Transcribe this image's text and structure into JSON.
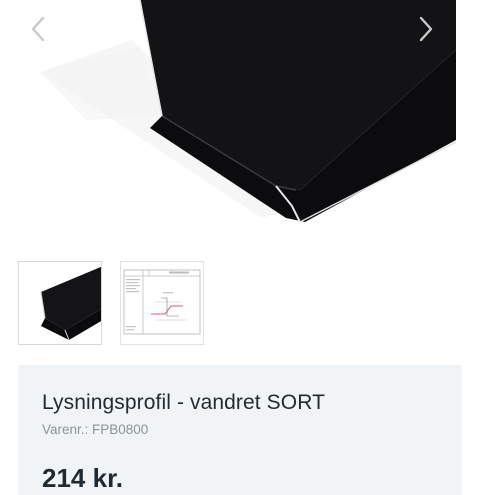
{
  "gallery": {
    "main_image": "lysningsprofil-black-profile-photo",
    "prev_icon": "chevron-left-icon",
    "next_icon": "chevron-right-icon",
    "thumbnails": [
      {
        "name": "thumbnail-photo",
        "image": "black-profile-photo",
        "selected": true
      },
      {
        "name": "thumbnail-drawing",
        "image": "technical-drawing",
        "selected": false
      }
    ]
  },
  "product": {
    "title": "Lysningsprofil - vandret SORT",
    "sku_label": "Varenr.:",
    "sku": "FPB0800",
    "sku_text": "Varenr.: FPB0800",
    "price": "214 kr."
  },
  "colors": {
    "profile": "#111113",
    "card_background": "#f1f4f6",
    "title": "#1f2a33",
    "sku": "#8a949c",
    "arrow": "#c8c8c8"
  }
}
